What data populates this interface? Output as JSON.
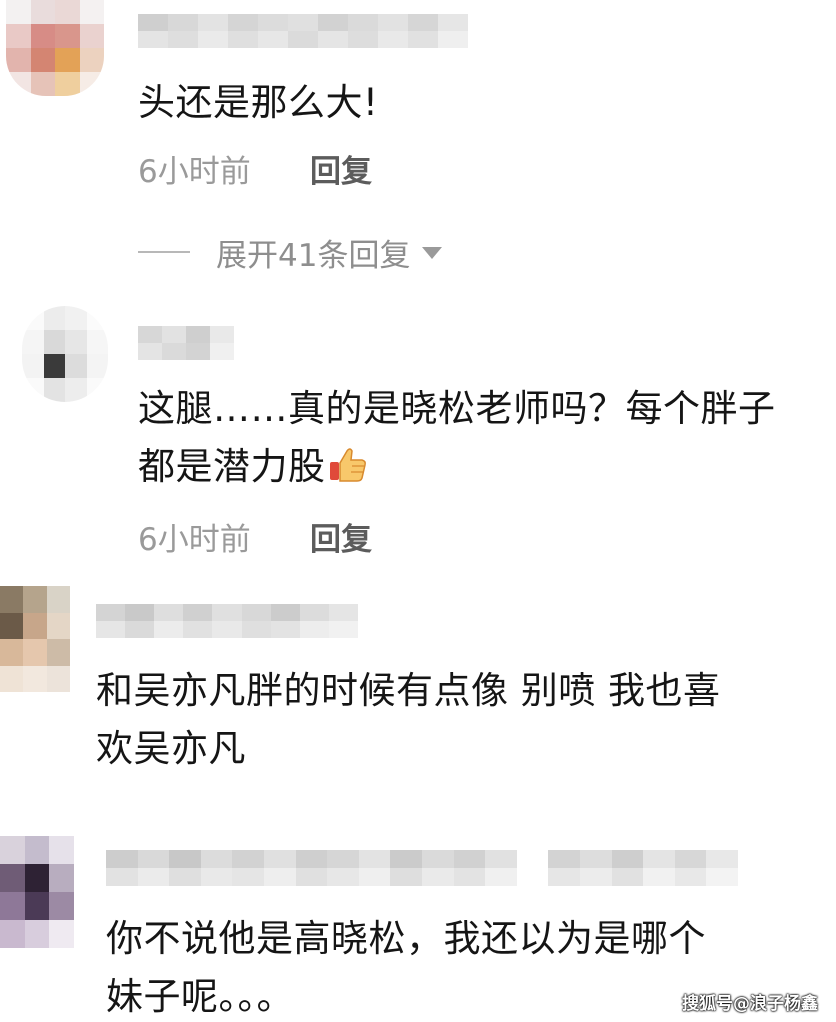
{
  "comments": [
    {
      "text_lines": [
        "头还是那么大!"
      ],
      "time": "6小时前",
      "reply_label": "回复",
      "expand_label": "展开41条回复"
    },
    {
      "text_lines": [
        "这腿……真的是晓松老师吗？每个胖子",
        "都是潜力股"
      ],
      "emoji": "thumbs-up-icon",
      "time": "6小时前",
      "reply_label": "回复"
    },
    {
      "text_lines": [
        "和吴亦凡胖的时候有点像 别喷 我也喜",
        "欢吴亦凡"
      ]
    },
    {
      "text_lines": [
        "你不说他是高晓松，我还以为是哪个",
        "妹子呢。。。"
      ]
    }
  ],
  "watermark": "搜狐号@浪子杨鑫",
  "colors": {
    "text": "#151515",
    "meta": "#9a9a9a",
    "reply": "#5c5c5c",
    "background": "#ffffff"
  }
}
